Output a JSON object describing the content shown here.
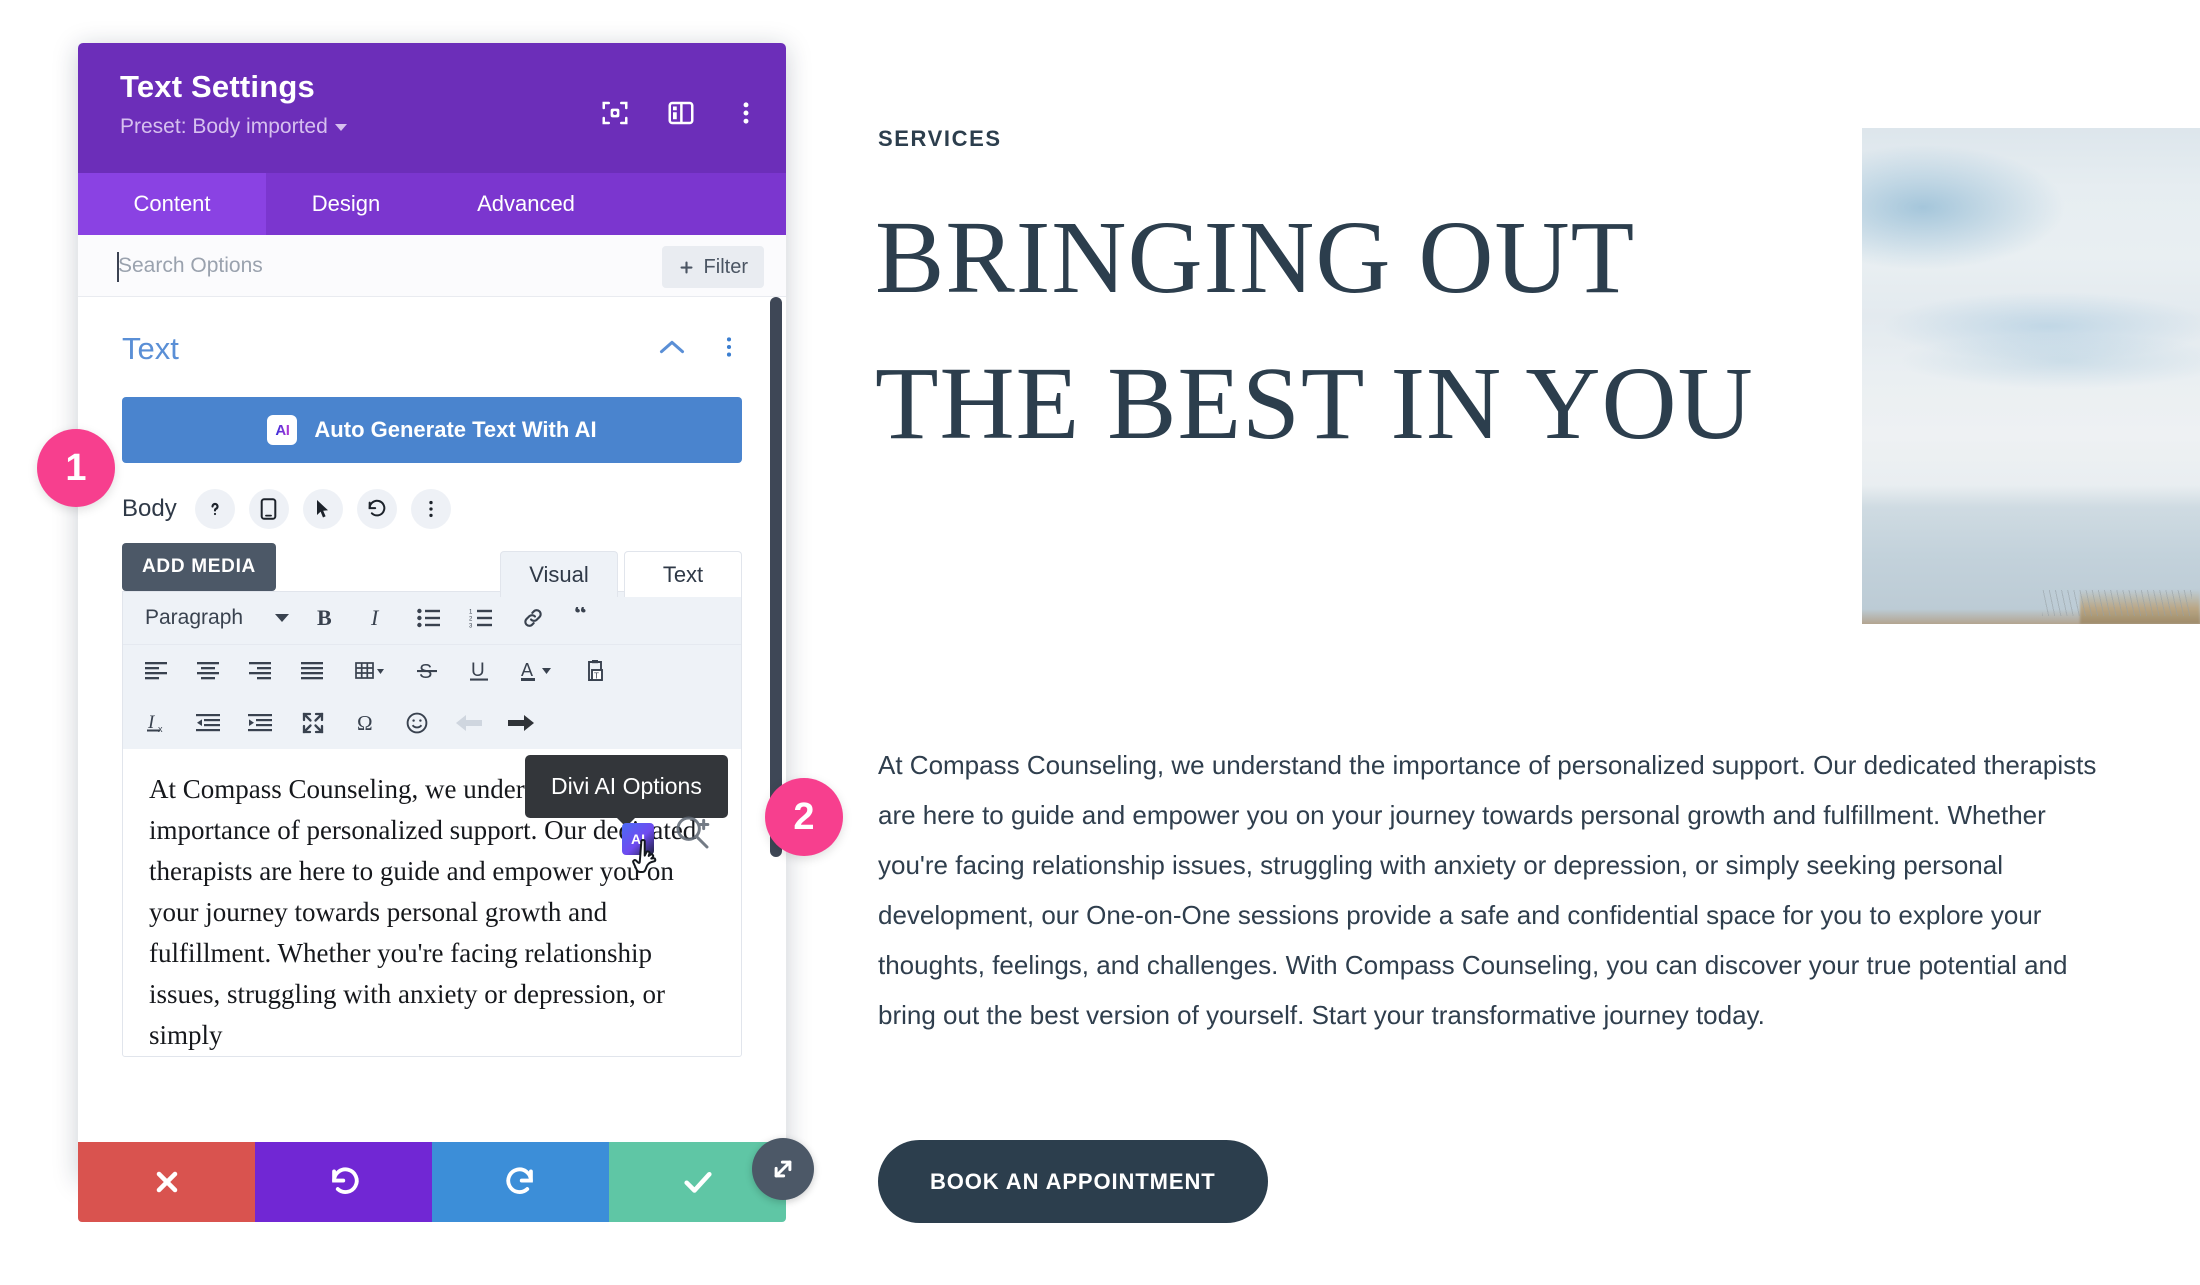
{
  "page": {
    "eyebrow": "SERVICES",
    "title": "BRINGING OUT THE BEST IN YOU",
    "body": "At Compass Counseling, we understand the importance of personalized support. Our dedicated therapists are here to guide and empower you on your journey towards personal growth and fulfillment. Whether you're facing relationship issues, struggling with anxiety or depression, or simply seeking personal development, our One-on-One sessions provide a safe and confidential space for you to explore your thoughts, feelings, and challenges. With Compass Counseling, you can discover your true potential and bring out the best version of yourself. Start your transformative journey today.",
    "cta_label": "BOOK AN APPOINTMENT",
    "hero_image_alt": "coastal-sky-ocean-photo"
  },
  "modal": {
    "title": "Text Settings",
    "preset_label": "Preset: Body imported",
    "header_icons": [
      "focus-target-icon",
      "layout-panel-icon",
      "vertical-ellipsis-icon"
    ],
    "tabs": [
      {
        "label": "Content",
        "active": true
      },
      {
        "label": "Design",
        "active": false
      },
      {
        "label": "Advanced",
        "active": false
      }
    ],
    "search": {
      "value": "",
      "placeholder": "Search Options",
      "filter_label": "Filter"
    },
    "section": {
      "title": "Text",
      "collapse_icon": "chevron-up-icon",
      "more_icon": "vertical-ellipsis-icon"
    },
    "ai_button": {
      "label": "Auto Generate Text With AI",
      "chip_label": "AI"
    },
    "body_field": {
      "label": "Body",
      "icons": [
        "help-icon",
        "responsive-mobile-icon",
        "hover-cursor-icon",
        "reset-undo-icon",
        "vertical-ellipsis-icon"
      ]
    },
    "editor": {
      "add_media_label": "ADD MEDIA",
      "view_tabs": [
        {
          "label": "Visual",
          "active": true
        },
        {
          "label": "Text",
          "active": false
        }
      ],
      "format_select": "Paragraph",
      "toolbar_row_1": [
        "bold-icon",
        "italic-icon",
        "bulleted-list-icon",
        "numbered-list-icon",
        "link-icon",
        "blockquote-icon"
      ],
      "toolbar_row_2": [
        "align-left-icon",
        "align-center-icon",
        "align-right-icon",
        "align-justify-icon",
        "table-icon",
        "strikethrough-icon",
        "underline-icon",
        "text-color-icon",
        "paste-as-text-icon"
      ],
      "toolbar_row_3": [
        "clear-formatting-icon",
        "outdent-icon",
        "indent-icon",
        "fullscreen-icon",
        "special-character-icon",
        "emoji-icon",
        "undo-arrow-icon",
        "redo-arrow-icon"
      ],
      "content": "At Compass Counseling, we understand the importance of personalized support. Our dedicated therapists are here to guide and empower you on your journey towards personal growth and fulfillment. Whether you're facing relationship issues, struggling with anxiety or depression, or simply"
    },
    "tooltip": "Divi AI Options",
    "inline_ai_badge": "AI",
    "action_bar": [
      {
        "name": "discard",
        "icon": "x-icon",
        "color": "#d9534f"
      },
      {
        "name": "undo",
        "icon": "undo-icon",
        "color": "#7127d4"
      },
      {
        "name": "redo",
        "icon": "redo-icon",
        "color": "#3c8ed8"
      },
      {
        "name": "save",
        "icon": "check-icon",
        "color": "#5fc6a5"
      }
    ],
    "resize_handle_icon": "diagonal-resize-icon"
  },
  "annotations": {
    "step_1": "1",
    "step_2": "2"
  },
  "colors": {
    "modal_header": "#6c2eb9",
    "tab_bar": "#7b36cf",
    "tab_active": "#8a42e3",
    "ai_button": "#4a84ce",
    "section_title": "#5a8fd6",
    "brand_dark": "#2c3e4d",
    "badge_pink": "#f73f8e"
  }
}
